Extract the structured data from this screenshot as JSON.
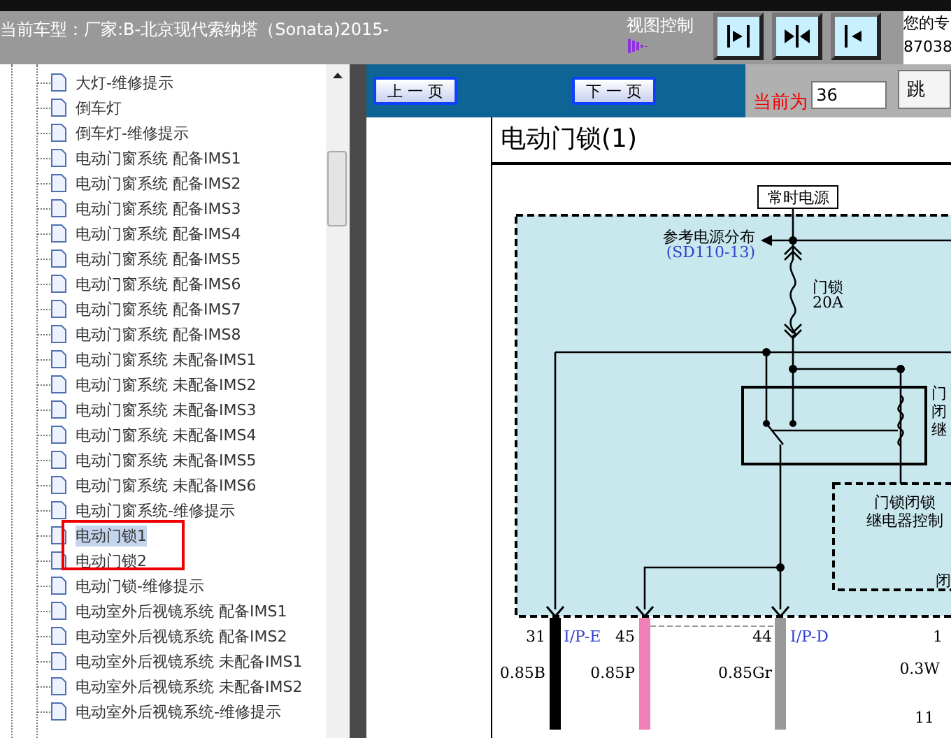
{
  "header": {
    "title": "当前车型：厂家:B-北京现代索纳塔（Sonata)2015-",
    "view_control": "视图控制",
    "view_buttons": [
      {
        "kind": "right"
      },
      {
        "kind": "both"
      },
      {
        "kind": "left"
      }
    ],
    "account_lines": [
      "您的专",
      "87038"
    ]
  },
  "tree": {
    "items": [
      {
        "label": "大灯-维修提示",
        "selected": false
      },
      {
        "label": "倒车灯",
        "selected": false
      },
      {
        "label": "倒车灯-维修提示",
        "selected": false
      },
      {
        "label": "电动门窗系统 配备IMS1",
        "selected": false
      },
      {
        "label": "电动门窗系统 配备IMS2",
        "selected": false
      },
      {
        "label": "电动门窗系统 配备IMS3",
        "selected": false
      },
      {
        "label": "电动门窗系统 配备IMS4",
        "selected": false
      },
      {
        "label": "电动门窗系统 配备IMS5",
        "selected": false
      },
      {
        "label": "电动门窗系统 配备IMS6",
        "selected": false
      },
      {
        "label": "电动门窗系统 配备IMS7",
        "selected": false
      },
      {
        "label": "电动门窗系统 配备IMS8",
        "selected": false
      },
      {
        "label": "电动门窗系统 未配备IMS1",
        "selected": false
      },
      {
        "label": "电动门窗系统 未配备IMS2",
        "selected": false
      },
      {
        "label": "电动门窗系统 未配备IMS3",
        "selected": false
      },
      {
        "label": "电动门窗系统 未配备IMS4",
        "selected": false
      },
      {
        "label": "电动门窗系统 未配备IMS5",
        "selected": false
      },
      {
        "label": "电动门窗系统 未配备IMS6",
        "selected": false
      },
      {
        "label": "电动门窗系统-维修提示",
        "selected": false
      },
      {
        "label": "电动门锁1",
        "selected": true
      },
      {
        "label": "电动门锁2",
        "selected": false
      },
      {
        "label": "电动门锁-维修提示",
        "selected": false
      },
      {
        "label": "电动室外后视镜系统 配备IMS1",
        "selected": false
      },
      {
        "label": "电动室外后视镜系统 配备IMS2",
        "selected": false
      },
      {
        "label": "电动室外后视镜系统 未配备IMS1",
        "selected": false
      },
      {
        "label": "电动室外后视镜系统 未配备IMS2",
        "selected": false
      },
      {
        "label": "电动室外后视镜系统-维修提示",
        "selected": false
      }
    ]
  },
  "nav": {
    "prev": "上 一 页",
    "next": "下 一 页",
    "current_label": "当前为",
    "page": "36",
    "jump": "跳"
  },
  "document": {
    "title": "电动门锁(1)",
    "labels": [
      {
        "text": "常时电源",
        "kind": "boxed"
      },
      {
        "text": "参考电源分布",
        "kind": "plain"
      },
      {
        "text": "(SD110-13)",
        "kind": "link"
      },
      {
        "text": "门锁",
        "kind": "plain"
      },
      {
        "text": "20A",
        "kind": "plain"
      },
      {
        "text": "门",
        "kind": "plain"
      },
      {
        "text": "闭",
        "kind": "plain"
      },
      {
        "text": "继",
        "kind": "plain"
      },
      {
        "text": "门锁闭锁",
        "kind": "plain"
      },
      {
        "text": "继电器控制",
        "kind": "plain"
      },
      {
        "text": "闭",
        "kind": "plain"
      },
      {
        "text": "31",
        "kind": "plain"
      },
      {
        "text": "I/P-E",
        "kind": "link"
      },
      {
        "text": "45",
        "kind": "plain"
      },
      {
        "text": "44",
        "kind": "plain"
      },
      {
        "text": "I/P-D",
        "kind": "link"
      },
      {
        "text": "1",
        "kind": "plain"
      },
      {
        "text": "0.85B",
        "kind": "plain"
      },
      {
        "text": "0.85P",
        "kind": "plain"
      },
      {
        "text": "0.85Gr",
        "kind": "plain"
      },
      {
        "text": "0.3W",
        "kind": "plain"
      },
      {
        "text": "11",
        "kind": "plain"
      }
    ]
  }
}
